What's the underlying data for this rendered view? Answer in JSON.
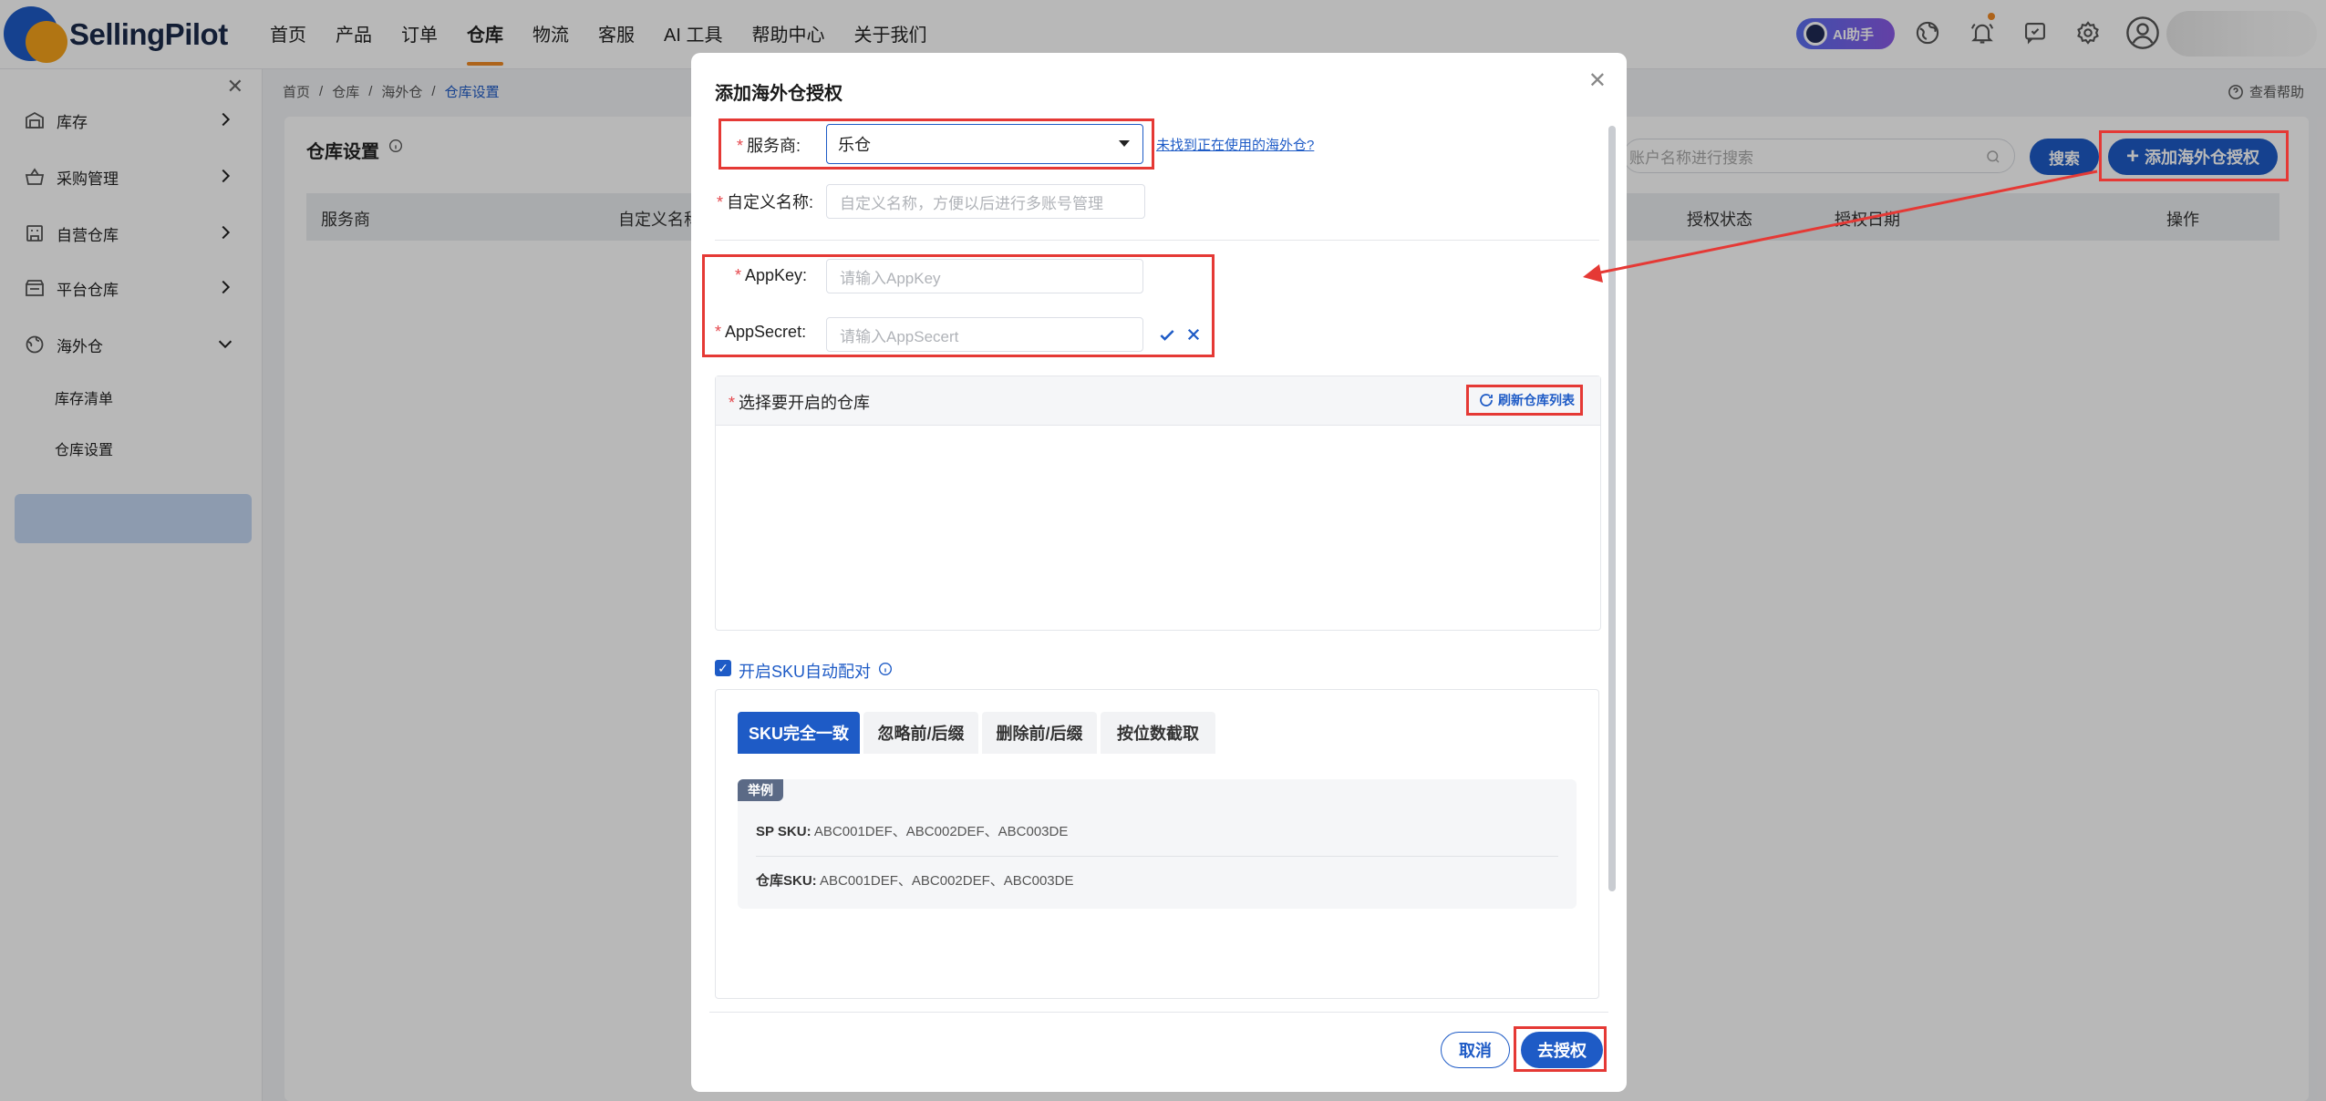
{
  "app": {
    "brand": "SellingPilot"
  },
  "nav": {
    "items": [
      "首页",
      "产品",
      "订单",
      "仓库",
      "物流",
      "客服",
      "AI 工具",
      "帮助中心",
      "关于我们"
    ],
    "active_index": 3
  },
  "top_right": {
    "ai_label": "AI助手"
  },
  "sidebar": {
    "groups": [
      {
        "label": "库存",
        "icon": "warehouse-icon"
      },
      {
        "label": "采购管理",
        "icon": "basket-icon"
      },
      {
        "label": "自营仓库",
        "icon": "building-icon"
      },
      {
        "label": "平台仓库",
        "icon": "store-icon"
      },
      {
        "label": "海外仓",
        "icon": "globe-icon",
        "expanded": true
      }
    ],
    "sub_items": [
      "库存清单",
      "仓库设置"
    ],
    "selected_sub": "仓库设置"
  },
  "breadcrumb": [
    "首页",
    "仓库",
    "海外仓",
    "仓库设置"
  ],
  "help_label": "查看帮助",
  "page": {
    "title": "仓库设置",
    "search_placeholder": "账户名称进行搜索",
    "search_button": "搜索",
    "add_button": "添加海外仓授权",
    "columns": [
      "服务商",
      "自定义名称",
      "授权状态",
      "授权日期",
      "操作"
    ]
  },
  "modal": {
    "title": "添加海外仓授权",
    "provider_label": "服务商:",
    "provider_value": "乐仓",
    "not_found_link": "未找到正在使用的海外仓?",
    "custom_name_label": "自定义名称:",
    "custom_name_placeholder": "自定义名称，方便以后进行多账号管理",
    "appkey_label": "AppKey:",
    "appkey_placeholder": "请输入AppKey",
    "appsecret_label": "AppSecret:",
    "appsecret_placeholder": "请输入AppSecert",
    "warehouse_select_label": "选择要开启的仓库",
    "refresh_label": "刷新仓库列表",
    "sku_auto_match_label": "开启SKU自动配对",
    "sku_auto_match_checked": true,
    "tabs": [
      "SKU完全一致",
      "忽略前/后缀",
      "删除前/后缀",
      "按位数截取"
    ],
    "active_tab": 0,
    "example_tag": "举例",
    "example_sp_label": "SP SKU:",
    "example_sp_value": "ABC001DEF、ABC002DEF、ABC003DE",
    "example_wh_label": "仓库SKU:",
    "example_wh_value": "ABC001DEF、ABC002DEF、ABC003DE",
    "cancel": "取消",
    "confirm": "去授权"
  },
  "colors": {
    "primary": "#1e5bc6",
    "accent": "#f08a24",
    "annotation": "#e53935"
  }
}
